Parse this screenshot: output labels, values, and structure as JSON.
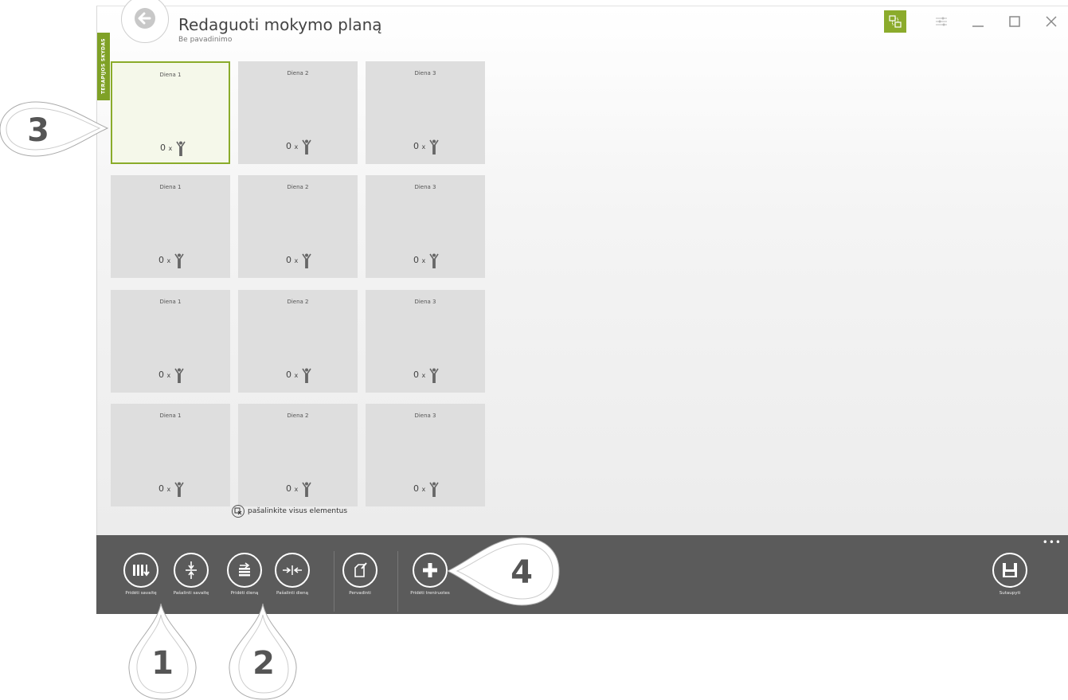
{
  "window": {
    "title": "Redaguoti mokymo planą",
    "subtitle": "Be pavadinimo",
    "side_tab": "TERAPIJOS SKYDAS"
  },
  "grid": {
    "rows": [
      [
        {
          "day": "Diena 1",
          "count": "0",
          "x": "x"
        },
        {
          "day": "Diena 2",
          "count": "0",
          "x": "x"
        },
        {
          "day": "Diena 3",
          "count": "0",
          "x": "x"
        }
      ],
      [
        {
          "day": "Diena 1",
          "count": "0",
          "x": "x"
        },
        {
          "day": "Diena 2",
          "count": "0",
          "x": "x"
        },
        {
          "day": "Diena 3",
          "count": "0",
          "x": "x"
        }
      ],
      [
        {
          "day": "Diena 1",
          "count": "0",
          "x": "x"
        },
        {
          "day": "Diena 2",
          "count": "0",
          "x": "x"
        },
        {
          "day": "Diena 3",
          "count": "0",
          "x": "x"
        }
      ],
      [
        {
          "day": "Diena 1",
          "count": "0",
          "x": "x"
        },
        {
          "day": "Diena 2",
          "count": "0",
          "x": "x"
        },
        {
          "day": "Diena 3",
          "count": "0",
          "x": "x"
        }
      ]
    ],
    "remove_all": "pašalinkite visus elementus"
  },
  "appbar": {
    "add_week": "Pridėti savaitę",
    "remove_week": "Pašalinti savaitę",
    "add_day": "Pridėti dieną",
    "remove_day": "Pašalinti dieną",
    "rename": "Pervadinti",
    "add_workouts": "Pridėti treniruotes",
    "save": "Sutaupyti",
    "more": "•••"
  },
  "callouts": [
    "1",
    "2",
    "3",
    "4"
  ],
  "colors": {
    "accent": "#8bab2c",
    "appbar": "#5b5b5b",
    "tile": "#dedede"
  }
}
